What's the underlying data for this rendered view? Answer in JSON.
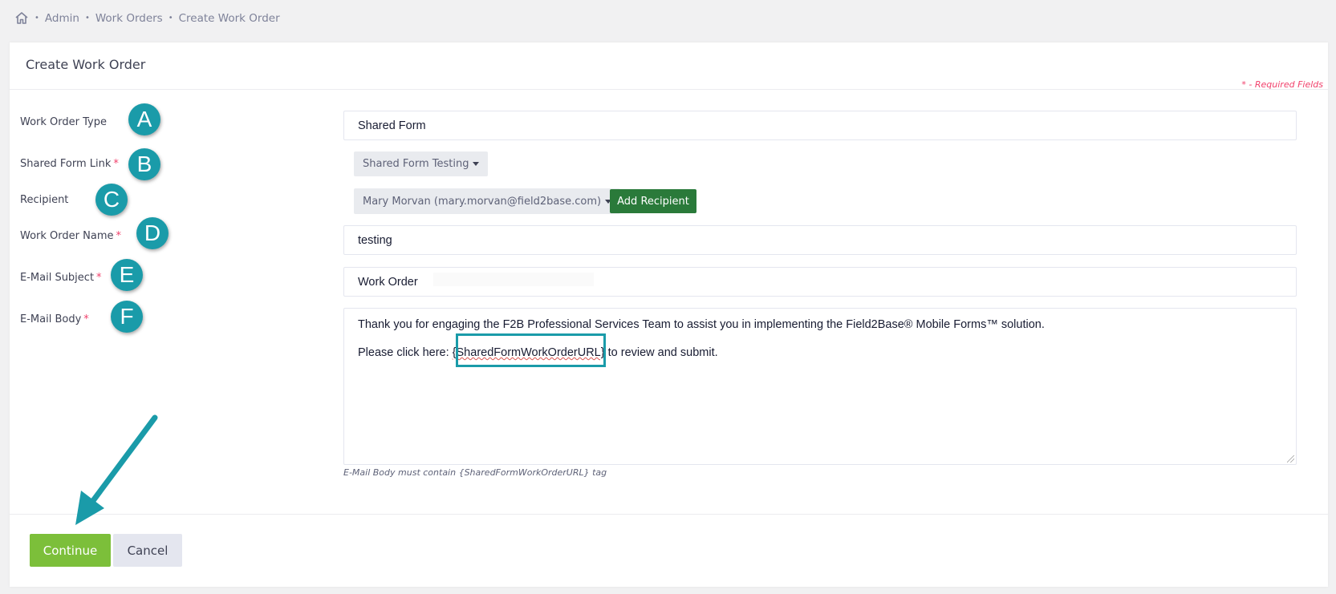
{
  "breadcrumb": {
    "home_icon": "home-icon",
    "items": [
      "Admin",
      "Work Orders",
      "Create Work Order"
    ],
    "separator": "•"
  },
  "card": {
    "title": "Create Work Order",
    "required_note": "* - Required Fields"
  },
  "fields": {
    "work_order_type": {
      "label": "Work Order Type",
      "value": "Shared Form",
      "marker": "A"
    },
    "shared_form_link": {
      "label": "Shared Form Link",
      "required": "*",
      "selected": "Shared Form Testing",
      "marker": "B"
    },
    "recipient": {
      "label": "Recipient",
      "selected": "Mary Morvan (mary.morvan@field2base.com)",
      "add_button": "Add Recipient",
      "marker": "C"
    },
    "work_order_name": {
      "label": "Work Order Name",
      "required": "*",
      "value": "testing",
      "marker": "D"
    },
    "email_subject": {
      "label": "E-Mail Subject",
      "required": "*",
      "value": "Work Order",
      "marker": "E"
    },
    "email_body": {
      "label": "E-Mail Body",
      "required": "*",
      "marker": "F",
      "line1": "Thank you for engaging the F2B Professional Services Team to assist you in implementing the Field2Base® Mobile Forms™ solution.",
      "line2_prefix": "Please click here: ",
      "line2_tag": "{SharedFormWorkOrderURL}",
      "line2_suffix": " to review and submit.",
      "hint": "E-Mail Body must contain {SharedFormWorkOrderURL} tag"
    }
  },
  "actions": {
    "continue_label": "Continue",
    "cancel_label": "Cancel"
  },
  "colors": {
    "marker": "#1a9ba9",
    "continue": "#7cbf3a",
    "add_recipient": "#2a7a3a",
    "required": "#f1416c"
  }
}
